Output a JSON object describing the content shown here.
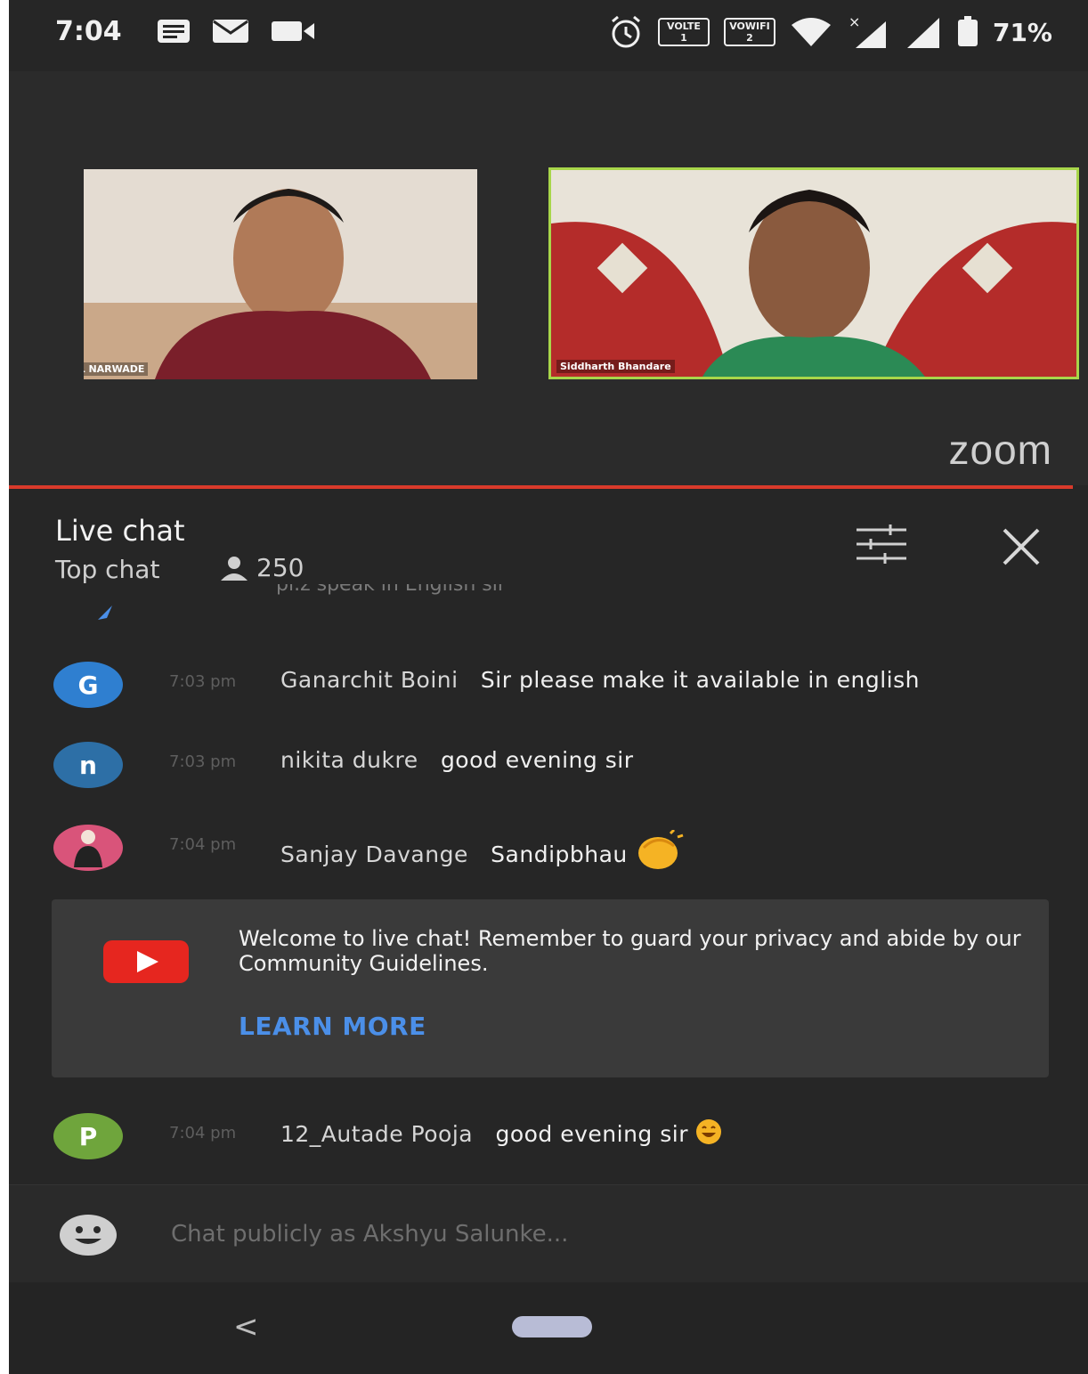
{
  "status_bar": {
    "time": "7:04",
    "left_icons": [
      "notes-icon",
      "mail-icon",
      "video-icon"
    ],
    "badge_volte": "VOLTE",
    "badge_volte_sub": "1",
    "badge_vowifi": "VOWIFI",
    "badge_vowifi_sub": "2",
    "battery": "71%"
  },
  "video": {
    "tiles": [
      {
        "name": "IAS VISHAL NARWADE"
      },
      {
        "name": "Siddharth Bhandare"
      }
    ],
    "logo": "zoom"
  },
  "chat_header": {
    "title": "Live chat",
    "mode": "Top chat",
    "viewers": "250"
  },
  "partial_message": "pl.z speak in English sir",
  "messages": [
    {
      "avatar_letter": "G",
      "avatar_color": "#2f7fd0",
      "time": "7:03 pm",
      "author": "Ganarchit Boini",
      "text": "Sir please make it available in english"
    },
    {
      "avatar_letter": "n",
      "avatar_color": "#2d6fa6",
      "time": "7:03 pm",
      "author": "nikita dukre",
      "text": "good evening sir"
    },
    {
      "avatar_letter": "",
      "avatar_color": "#d9547a",
      "time": "7:04 pm",
      "author": "Sanjay Davange",
      "text": "Sandipbhau"
    },
    {
      "avatar_letter": "P",
      "avatar_color": "#6fa53c",
      "time": "7:04 pm",
      "author": "12_Autade Pooja",
      "text": "good evening sir"
    }
  ],
  "welcome": {
    "text": "Welcome to live chat! Remember to guard your privacy and abide by our Community Guidelines.",
    "learn_more": "LEARN MORE"
  },
  "input": {
    "placeholder": "Chat publicly as Akshyu Salunke..."
  },
  "nav": {
    "back": "<"
  },
  "colors": {
    "accent_red": "#d93a2b",
    "link_blue": "#4b8fe8",
    "youtube_red": "#e6261f",
    "tile_border": "#a8d64a"
  }
}
